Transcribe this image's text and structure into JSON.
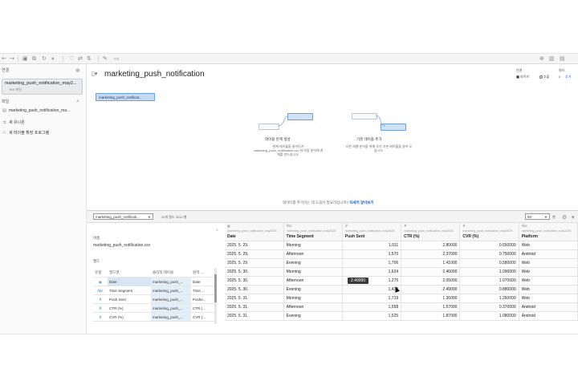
{
  "sidebar": {
    "connections_label": "연결",
    "data_source": {
      "name": "marketing_push_notification_may2...",
      "sub": "Text 파일"
    },
    "files_label": "파일",
    "items": [
      {
        "icon": "file-icon",
        "label": "marketing_push_notification_ma..."
      },
      {
        "icon": "union-icon",
        "label": "새 유니온"
      },
      {
        "icon": "extension-icon",
        "label": "새 테이블 확장 프로그램"
      }
    ]
  },
  "main": {
    "title": "marketing_push_notification",
    "connection": {
      "label": "연결",
      "live": "라이브",
      "extract": "추출"
    },
    "filter": {
      "label": "필터",
      "count": "0",
      "add": "추가"
    },
    "canvas_node": "marketing_push_notificat...",
    "card_relations": {
      "title": "테이블 관계 생성",
      "desc": "관계 테이블을 끌어다가 marketing_push_notification.csv 와 자동 분석에 관계를 만드십시오."
    },
    "card_add": {
      "title": "기본 테이블 추가",
      "desc": "다른 레벨 분석을 위해 추가 기본 테이블을 끌어 오십시오."
    },
    "help_text": "데이터를 추가하는 데 도움이 필요하십니까?",
    "help_link": "자세히 알아보기"
  },
  "bottom": {
    "table_select": "marketing_push_notificati...",
    "table_info": "20개 필드 3313 행",
    "rows_value": "50",
    "rows_label": "행",
    "left": {
      "name_label": "이름",
      "name_value": "marketing_push_notification.csv",
      "fields_label": "필드",
      "headers": [
        "유형",
        "필드명",
        "물리적 테이블",
        "원격 ..."
      ],
      "rows": [
        {
          "type": "calendar-icon",
          "field": "Date",
          "table": "marketing_push_...",
          "remote": "Date"
        },
        {
          "type": "abc-icon",
          "field": "Time Segment",
          "table": "marketing_push_...",
          "remote": "Time ..."
        },
        {
          "type": "number-icon",
          "field": "Push Sent",
          "table": "marketing_push_...",
          "remote": "Pushe..."
        },
        {
          "type": "number-icon",
          "field": "CTR (%)",
          "table": "marketing_push_...",
          "remote": "CTR (..."
        },
        {
          "type": "number-icon",
          "field": "CVR (%)",
          "table": "marketing_push_...",
          "remote": "CVR (..."
        }
      ]
    },
    "grid": {
      "columns": [
        {
          "type_icon": "calendar-icon",
          "source": "marketing_push_notification_may2025",
          "name": "Date"
        },
        {
          "type_icon": "abc-icon",
          "source": "marketing_push_notification_may2025",
          "name": "Time Segment"
        },
        {
          "type_icon": "number-icon",
          "source": "marketing_push_notification_may2025",
          "name": "Push Sent"
        },
        {
          "type_icon": "number-icon",
          "source": "marketing_push_notification_may2025",
          "name": "CTR (%)"
        },
        {
          "type_icon": "number-icon",
          "source": "marketing_push_notification_may2025",
          "name": "CVR (%)"
        },
        {
          "type_icon": "abc-icon",
          "source": "marketing_push_notification_may2025",
          "name": "Platform"
        }
      ],
      "rows": [
        [
          "2025. 5. 29.",
          "Morning",
          "1,011",
          "2.80000",
          "0.650000",
          "Web"
        ],
        [
          "2025. 5. 29.",
          "Afternoon",
          "1,570",
          "2.37000",
          "0.750000",
          "Android"
        ],
        [
          "2025. 5. 29.",
          "Evening",
          "1,706",
          "1.41000",
          "0.580000",
          "Web"
        ],
        [
          "2025. 5. 30.",
          "Morning",
          "1,624",
          "2.46000",
          "1.090000",
          "Web"
        ],
        [
          "2025. 5. 30.",
          "Afternoon",
          "1,275",
          "2.05000",
          "1.070000",
          "Web"
        ],
        [
          "2025. 5. 30.",
          "Evening",
          "1,432",
          "2.49000",
          "0.880000",
          "Web"
        ],
        [
          "2025. 5. 31.",
          "Morning",
          "1,719",
          "1.36000",
          "1.260000",
          "Web"
        ],
        [
          "2025. 5. 31.",
          "Afternoon",
          "1,558",
          "1.57000",
          "0.370000",
          "Android"
        ],
        [
          "2025. 5. 31.",
          "Evening",
          "1,525",
          "1.87000",
          "1.080000",
          "Android"
        ]
      ],
      "tooltip": "2.49000"
    }
  }
}
